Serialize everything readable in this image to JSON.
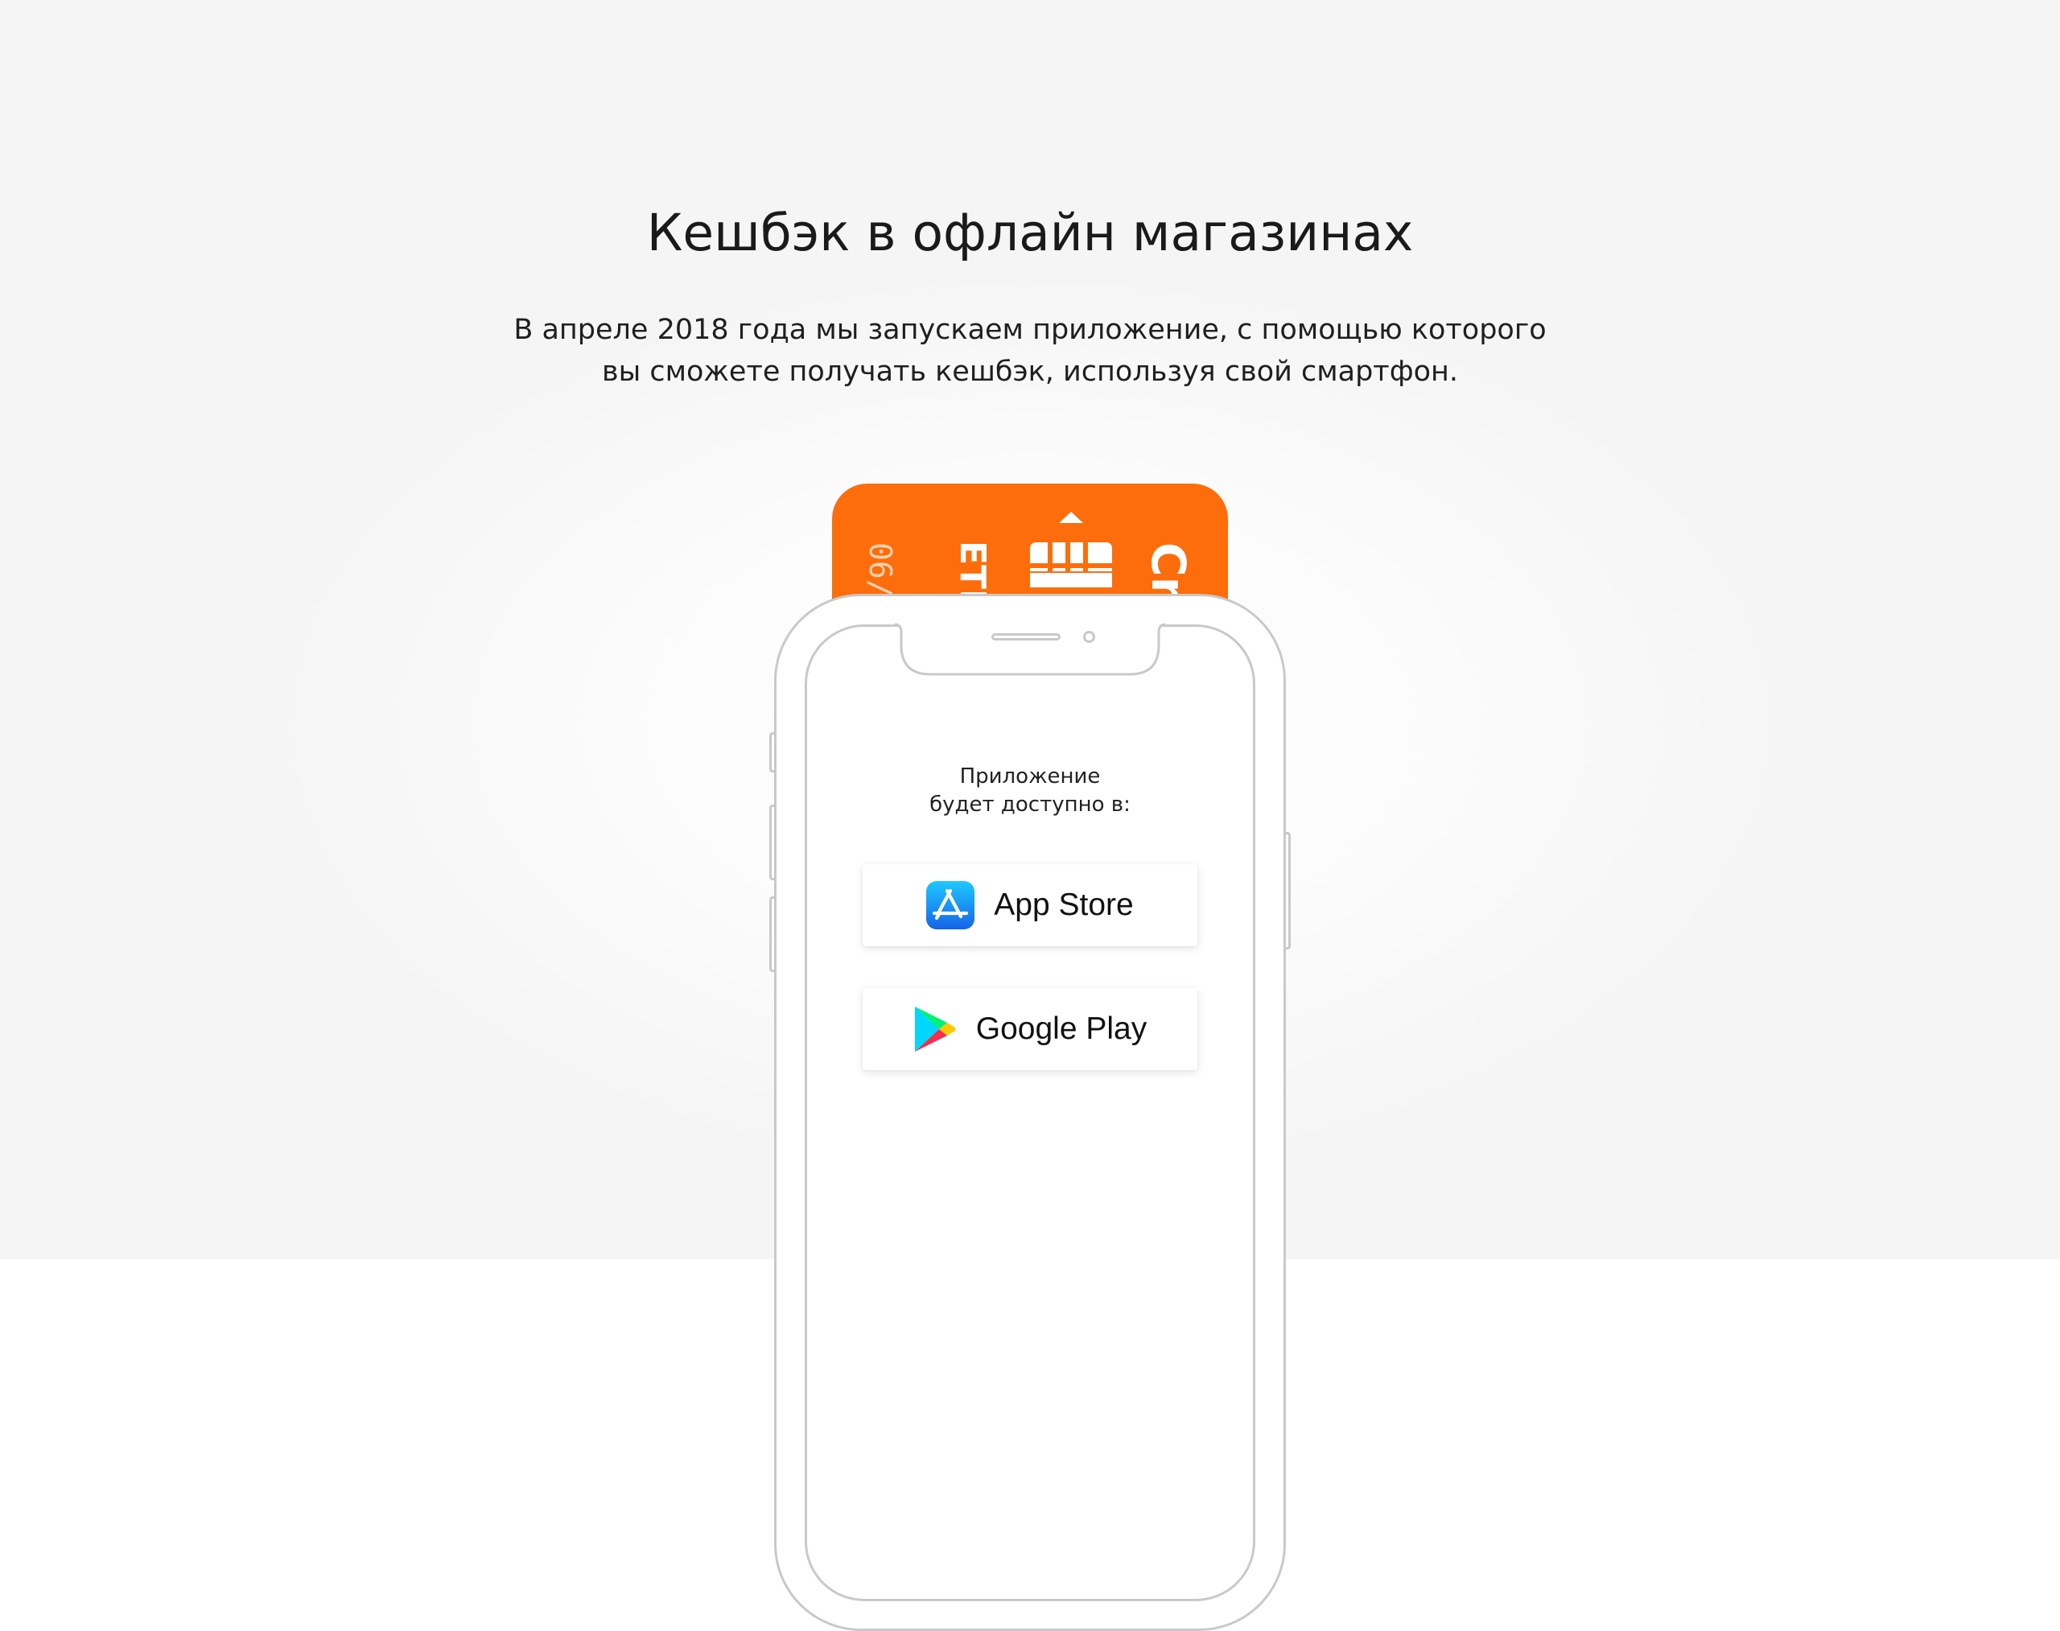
{
  "section": {
    "title": "Кешбэк в офлайн магазинах",
    "subtitle_line1": "В апреле 2018 года мы запускаем приложение, с помощью которого",
    "subtitle_line2": "вы сможете получать кешбэк, используя свой смартфон."
  },
  "card": {
    "color": "#fd6d0b",
    "number_fragment": "06/",
    "name_fragment": "ЕТИ",
    "brand_fragment": "Cr"
  },
  "phone": {
    "availability_line1": "Приложение",
    "availability_line2": "будет доступно в:",
    "stores": [
      {
        "label": "App Store",
        "icon": "app-store-icon"
      },
      {
        "label": "Google Play",
        "icon": "google-play-icon"
      }
    ]
  },
  "colors": {
    "accent_orange": "#fd6d0b",
    "background_gray": "#f5f5f5",
    "phone_outline": "#c9c9c9"
  }
}
